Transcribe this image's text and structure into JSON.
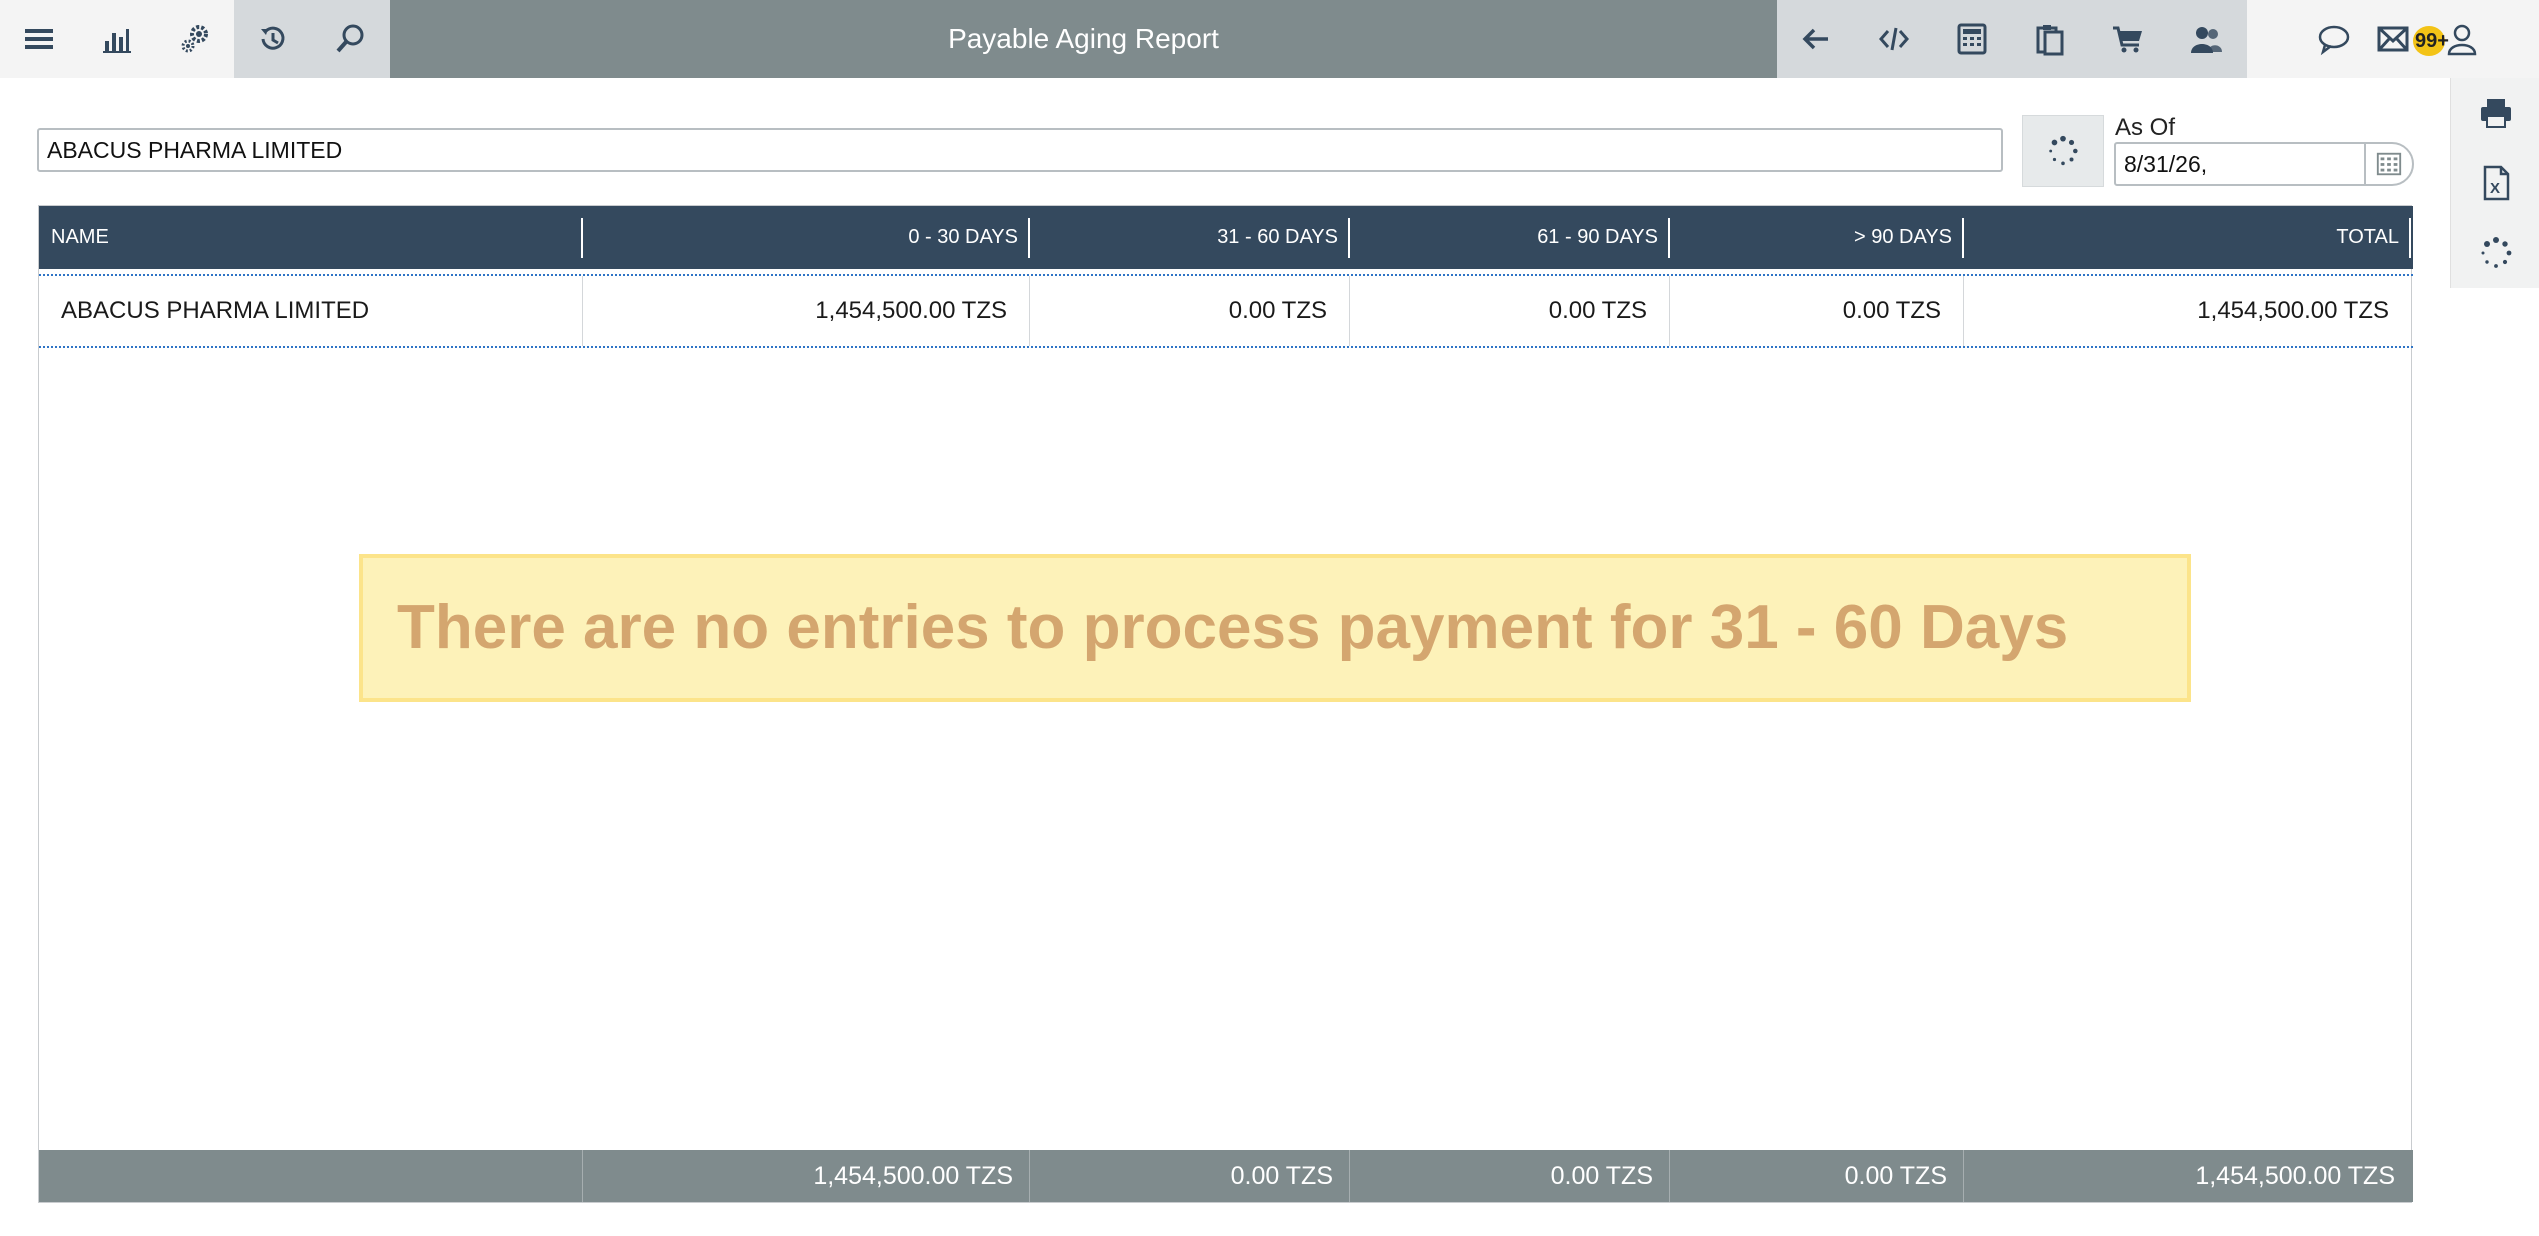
{
  "app": {
    "title": "Payable Aging Report",
    "notification_count": "99+"
  },
  "toolbar_left": [
    "menu-icon",
    "bar-chart-icon",
    "gears-icon",
    "history-icon",
    "search-icon"
  ],
  "toolbar_right": [
    "arrow-left-icon",
    "code-icon",
    "calculator-icon",
    "clipboard-icon",
    "cart-icon",
    "user-group-icon",
    "chat-icon",
    "mail-icon",
    "user-icon"
  ],
  "filters": {
    "vendor": "ABACUS PHARMA LIMITED",
    "as_of_label": "As Of",
    "as_of_value": "8/31/26,"
  },
  "table": {
    "columns": [
      "NAME",
      "0 - 30 DAYS",
      "31 - 60 DAYS",
      "61 - 90 DAYS",
      "> 90 DAYS",
      "TOTAL"
    ],
    "rows": [
      [
        "ABACUS PHARMA LIMITED",
        "1,454,500.00 TZS",
        "0.00 TZS",
        "0.00 TZS",
        "0.00 TZS",
        "1,454,500.00 TZS"
      ]
    ],
    "footer": [
      "",
      "1,454,500.00 TZS",
      "0.00 TZS",
      "0.00 TZS",
      "0.00 TZS",
      "1,454,500.00 TZS"
    ]
  },
  "notice": "There are no entries to process payment for 31 - 60 Days",
  "colors": {
    "header": "#34495e",
    "topbar": "#7f8b8d",
    "notice_bg": "#fdf2b9",
    "notice_text": "#d4a66f",
    "badge": "#f3c316"
  }
}
